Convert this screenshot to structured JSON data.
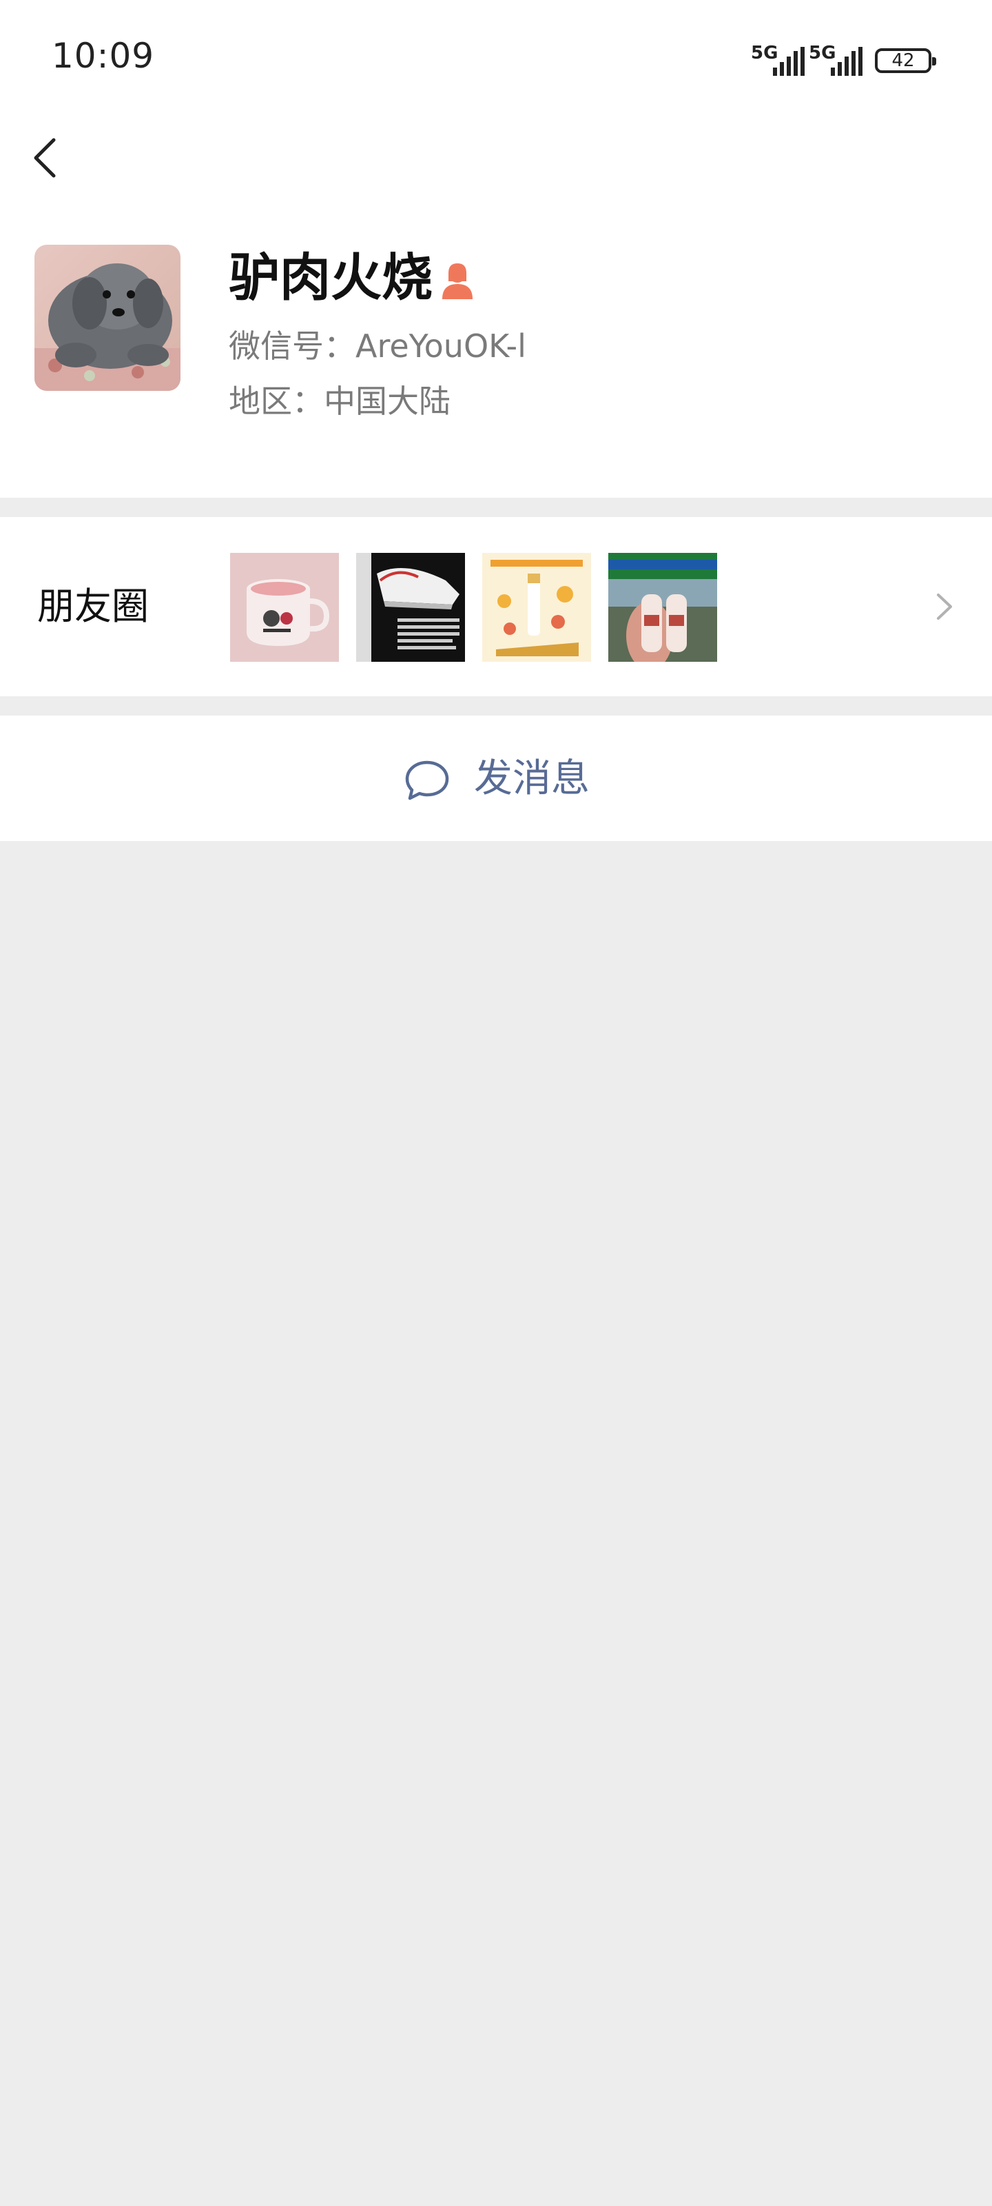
{
  "status_bar": {
    "time": "10:09",
    "signal_1": "5G",
    "signal_2": "5G",
    "battery": "42"
  },
  "profile": {
    "name": "驴肉火烧",
    "gender_icon": "female-icon",
    "wechat_id": "微信号：AreYouOK-l",
    "region": "地区：中国大陆"
  },
  "moments": {
    "label": "朋友圈",
    "thumbnails": [
      "pink-mug-photo",
      "sneaker-poster",
      "drink-promo-poster",
      "familymart-drinks-photo"
    ]
  },
  "actions": {
    "send_message": "发消息"
  },
  "colors": {
    "accent": "#576b95",
    "gender": "#f0785a",
    "background": "#ededed",
    "surface": "#ffffff"
  }
}
